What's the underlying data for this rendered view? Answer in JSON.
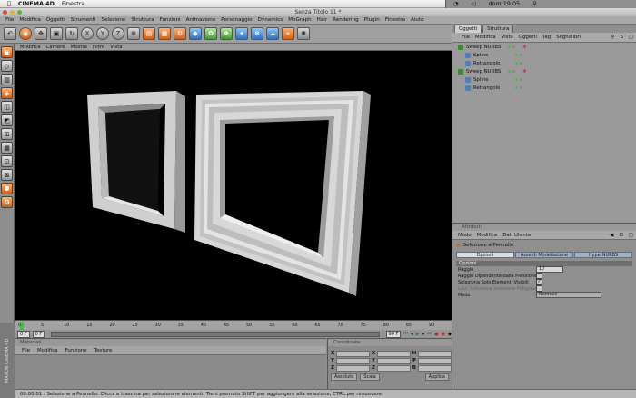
{
  "mac_menu": {
    "app": "CINEMA 4D",
    "window": "Finestra",
    "clock": "dom 19:05"
  },
  "window_title": "Senza Titolo 11 *",
  "main_menu": [
    "File",
    "Modifica",
    "Oggetti",
    "Strumenti",
    "Selezione",
    "Struttura",
    "Funzioni",
    "Animazione",
    "Personaggio",
    "Dynamics",
    "MoGraph",
    "Hair",
    "Rendering",
    "Plugin",
    "Finestra",
    "Aiuto"
  ],
  "axis_buttons": [
    "X",
    "Y",
    "Z"
  ],
  "viewport_menu": [
    "Modifica",
    "Camere",
    "Mostra",
    "Filtro",
    "Vista"
  ],
  "timeline": {
    "ticks": [
      "0",
      "5",
      "10",
      "15",
      "20",
      "25",
      "30",
      "35",
      "40",
      "45",
      "50",
      "55",
      "60",
      "65",
      "70",
      "75",
      "80",
      "85",
      "90"
    ],
    "current": "0 F",
    "start": "0 F",
    "end": "90 F"
  },
  "materials": {
    "title": "Materiali",
    "menu": [
      "File",
      "Modifica",
      "Funzione",
      "Texture"
    ]
  },
  "coordinates": {
    "title": "Coordinate",
    "rows": [
      [
        "X",
        "X",
        "H"
      ],
      [
        "Y",
        "Y",
        "P"
      ],
      [
        "Z",
        "Z",
        "B"
      ]
    ],
    "btn_object": "Assoluto",
    "btn_size": "Scala",
    "btn_apply": "Applica"
  },
  "status_bar": "00:00:01 : Selezione a Pennello: Clicca e trascina per selezionare elementi. Tieni premuto SHIFT per aggiungere alla selezione, CTRL per rimuovere.",
  "brand_vertical": "MAXON CINEMA 4D",
  "objects_panel": {
    "tabs": [
      "Oggetti",
      "Struttura"
    ],
    "menu": [
      "File",
      "Modifica",
      "Vista",
      "Oggetti",
      "Tag",
      "Segnalibri"
    ],
    "tree": [
      {
        "name": "Sweep NURBS",
        "level": 0,
        "color": "#3a8a2e"
      },
      {
        "name": "Spline",
        "level": 1,
        "color": "#4a7fc4"
      },
      {
        "name": "Rettangolo",
        "level": 1,
        "color": "#4a7fc4"
      },
      {
        "name": "Sweep NURBS",
        "level": 0,
        "color": "#3a8a2e"
      },
      {
        "name": "Spline",
        "level": 1,
        "color": "#4a7fc4"
      },
      {
        "name": "Rettangolo",
        "level": 1,
        "color": "#4a7fc4"
      }
    ]
  },
  "attributes": {
    "title": "Attributi",
    "menu": [
      "Modo",
      "Modifica",
      "Dati Utente"
    ],
    "tool": "Selezione a Pennello",
    "tabs": [
      "Opzioni",
      "Asse di Modellazione",
      "HyperNURBS"
    ],
    "section": "Opzioni",
    "fields": {
      "radius_label": "Raggio",
      "radius_value": "10",
      "radius_dep": "Raggio Dipendente dalla Pressione",
      "visible_only": "Seleziona Solo Elementi Visibili",
      "tolerance": "Lato Tolleranza Selezione Poligonale",
      "mode_label": "Modo",
      "mode_value": "Normale"
    }
  }
}
